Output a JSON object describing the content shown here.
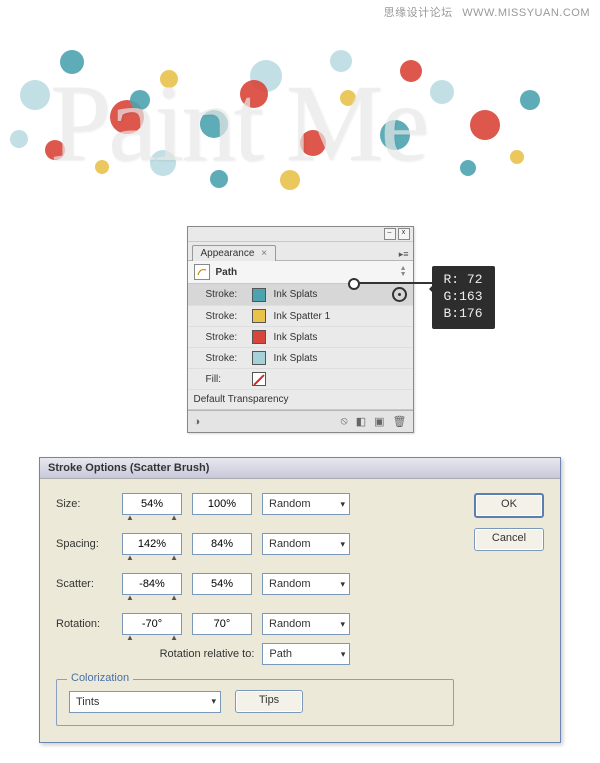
{
  "watermark": {
    "cn": "思缘设计论坛",
    "url": "WWW.MISSYUAN.COM"
  },
  "artwork_text": "Paint Me",
  "appearance": {
    "tab_label": "Appearance",
    "tab_close": "×",
    "path_label": "Path",
    "strokes": [
      {
        "label": "Stroke:",
        "name": "Ink Splats",
        "color": "#4ca3b0",
        "selected": true
      },
      {
        "label": "Stroke:",
        "name": "Ink Spatter 1",
        "color": "#e8c24b",
        "selected": false
      },
      {
        "label": "Stroke:",
        "name": "Ink Splats",
        "color": "#d9453a",
        "selected": false
      },
      {
        "label": "Stroke:",
        "name": "Ink Splats",
        "color": "#a6d1d8",
        "selected": false
      }
    ],
    "fill_label": "Fill:",
    "fill_value": "none",
    "default_transparency": "Default Transparency"
  },
  "rgb": {
    "r_label": "R:",
    "g_label": "G:",
    "b_label": "B:",
    "r": "72",
    "g": "163",
    "b": "176"
  },
  "dialog": {
    "title": "Stroke Options (Scatter Brush)",
    "ok": "OK",
    "cancel": "Cancel",
    "rows": {
      "size": {
        "label": "Size:",
        "a": "54%",
        "b": "100%",
        "mode": "Random"
      },
      "spacing": {
        "label": "Spacing:",
        "a": "142%",
        "b": "84%",
        "mode": "Random"
      },
      "scatter": {
        "label": "Scatter:",
        "a": "-84%",
        "b": "54%",
        "mode": "Random"
      },
      "rotation": {
        "label": "Rotation:",
        "a": "-70°",
        "b": "70°",
        "mode": "Random"
      }
    },
    "rotation_relative_label": "Rotation relative to:",
    "rotation_relative_value": "Path",
    "colorization": {
      "legend": "Colorization",
      "method": "Tints",
      "tips": "Tips"
    }
  }
}
